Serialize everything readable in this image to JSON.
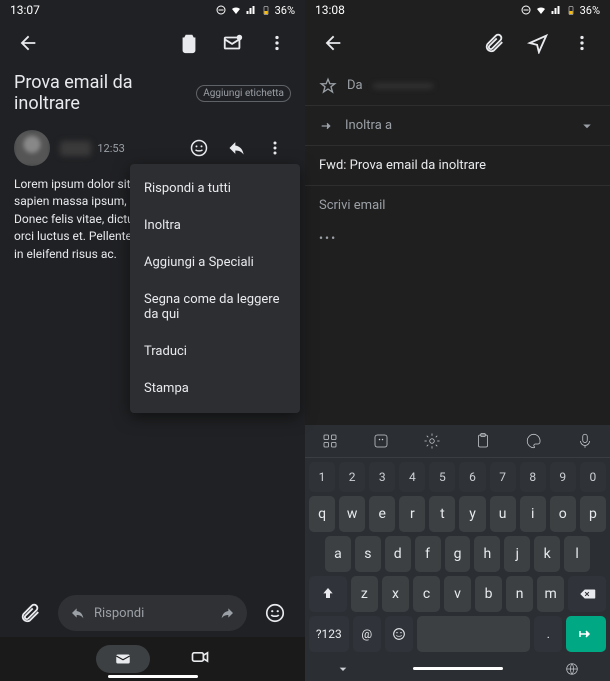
{
  "left": {
    "status": {
      "time": "13:07",
      "battery": "36%"
    },
    "subject": "Prova email da inoltrare",
    "add_label_chip": "Aggiungi etichetta",
    "message": {
      "time": "12:53",
      "body": "Lorem ipsum dolor sit amet, leo eros, sodales eu sapien massa ipsum, ultrices eu urna sapien eros. Donec felis vitae, dictum tincidunt sapien faucibus orci luctus et. Pellentesque quis interdum congue, in eleifend risus ac."
    },
    "menu": {
      "items": [
        "Rispondi a tutti",
        "Inoltra",
        "Aggiungi a Speciali",
        "Segna come da leggere da qui",
        "Traduci",
        "Stampa"
      ]
    },
    "reply_placeholder": "Rispondi"
  },
  "right": {
    "status": {
      "time": "13:08",
      "battery": "36%"
    },
    "compose": {
      "from_label": "Da",
      "to_label": "Inoltra a",
      "subject": "Fwd: Prova email da inoltrare",
      "body_placeholder": "Scrivi email"
    },
    "keyboard": {
      "numrow": [
        "1",
        "2",
        "3",
        "4",
        "5",
        "6",
        "7",
        "8",
        "9",
        "0"
      ],
      "row1": [
        "q",
        "w",
        "e",
        "r",
        "t",
        "y",
        "u",
        "i",
        "o",
        "p"
      ],
      "row2": [
        "a",
        "s",
        "d",
        "f",
        "g",
        "h",
        "j",
        "k",
        "l"
      ],
      "row3": [
        "z",
        "x",
        "c",
        "v",
        "b",
        "n",
        "m"
      ],
      "sym_key": "?123",
      "at_key": "@",
      "period_key": "."
    }
  }
}
